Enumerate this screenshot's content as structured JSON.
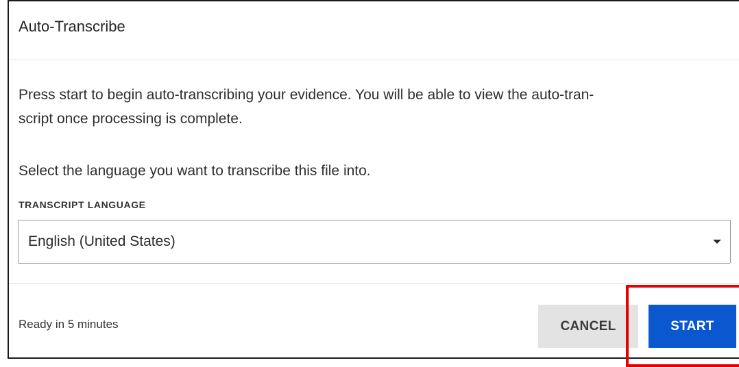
{
  "dialog": {
    "title": "Auto-Transcribe",
    "description": "Press start to begin auto-transcribing your evidence. You will be able to view the auto-tran-script once processing is complete.",
    "description_line1": "Press start to begin auto-transcribing your evidence. You will be able to view the auto-tran-",
    "description_line2": "script once processing is complete.",
    "prompt": "Select the language you want to transcribe this file into.",
    "language_field": {
      "label": "TRANSCRIPT LANGUAGE",
      "selected_value": "English (United States)",
      "icon": "dropdown-caret-icon"
    },
    "footer": {
      "status": "Ready in 5 minutes",
      "cancel_label": "CANCEL",
      "start_label": "START"
    }
  },
  "colors": {
    "primary_button": "#0a57d0",
    "secondary_button": "#e3e3e3",
    "highlight_box": "#e80000"
  }
}
